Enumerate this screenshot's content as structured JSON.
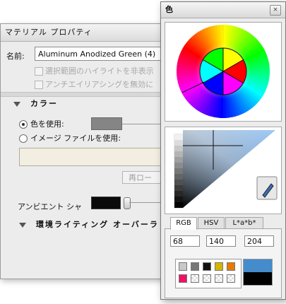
{
  "material_panel": {
    "title": "マテリアル プロパティ",
    "name_label": "名前:",
    "name_value": "Aluminum Anodized Green (4)",
    "checkbox_highlight": "選択範囲のハイライトを非表示",
    "checkbox_antialias": "アンチエイリアシングを無効に",
    "color_section": "カラー",
    "use_color": "色を使用:",
    "use_image": "イメージ ファイルを使用:",
    "reload_button": "再ロー",
    "ambient_label": "アンビエント シャ",
    "env_section": "環境ライティング オーバーラ",
    "colors": {
      "color_swatch": "#858585",
      "ambient_swatch": "#0a0a0a"
    }
  },
  "color_window": {
    "title": "色",
    "close_glyph": "×",
    "tabs": [
      {
        "label": "RGB",
        "active": true
      },
      {
        "label": "HSV",
        "active": false
      },
      {
        "label": "L*a*b*",
        "active": false
      }
    ],
    "rgb": {
      "r": "68",
      "g": "140",
      "b": "204"
    },
    "palette": [
      "#c9c9c9",
      "#777777",
      "#111111",
      "#d4b600",
      "#e87a00",
      "#ee1166"
    ],
    "preview": {
      "current": "#448ccc",
      "previous": "#000000"
    },
    "eyedropper_icon": "eyedropper-icon"
  }
}
